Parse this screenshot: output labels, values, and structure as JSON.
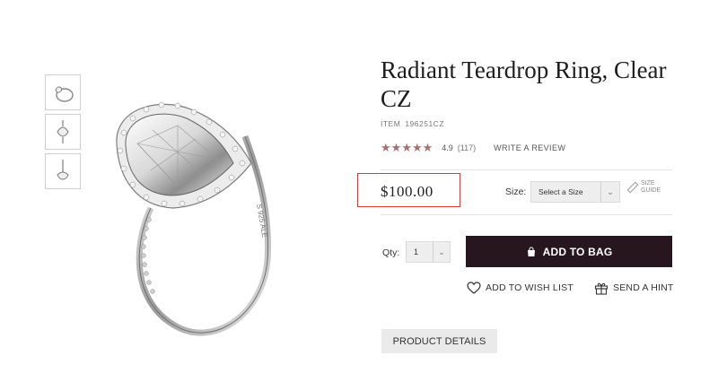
{
  "product": {
    "title": "Radiant Teardrop Ring, Clear CZ",
    "item_label": "ITEM",
    "item_code": "196251CZ",
    "rating_value": "4.9",
    "rating_stars": 5,
    "rating_count": "(117)",
    "write_review": "WRITE A REVIEW",
    "price": "$100.00"
  },
  "size": {
    "label": "Size:",
    "selected": "Select a Size",
    "guide": "SIZE GUIDE"
  },
  "qty": {
    "label": "Qty:",
    "selected": "1"
  },
  "actions": {
    "add_to_bag": "ADD TO BAG",
    "wish_list": "ADD TO WISH LIST",
    "send_hint": "SEND A HINT",
    "product_details": "PRODUCT DETAILS"
  },
  "thumbnails": [
    "ring-front-view",
    "ring-top-view",
    "ring-side-view"
  ],
  "colors": {
    "star": "#a6716d",
    "primary_button": "#28161e",
    "highlight_border": "#e0393e"
  },
  "icons": {
    "bag": "bag-icon",
    "heart": "heart-icon",
    "gift": "gift-icon",
    "ruler": "ruler-icon",
    "chevron": "chevron-down-icon"
  }
}
